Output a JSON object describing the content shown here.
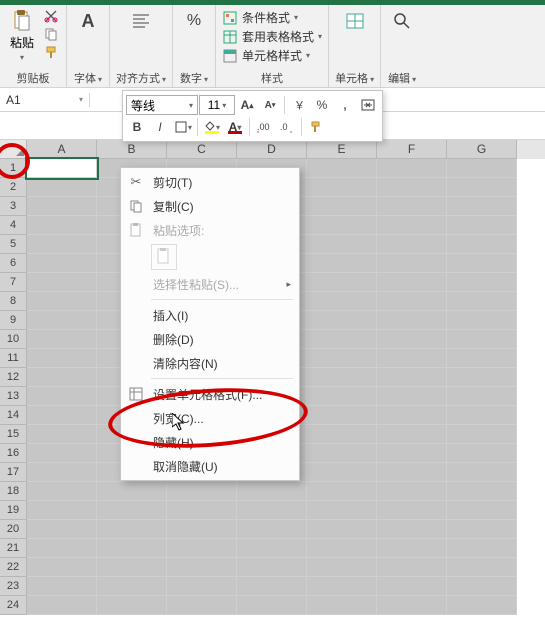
{
  "ribbon": {
    "clipboard": {
      "label": "剪贴板",
      "paste": "粘贴"
    },
    "font": {
      "label": "字体"
    },
    "alignment": {
      "label": "对齐方式"
    },
    "number": {
      "label": "数字"
    },
    "styles": {
      "label": "样式",
      "conditional": "条件格式",
      "formatTable": "套用表格格式",
      "cellStyles": "单元格样式"
    },
    "cells": {
      "label": "单元格"
    },
    "editing": {
      "label": "编辑"
    }
  },
  "mini": {
    "font": "等线",
    "size": "11",
    "bold": "B",
    "italic": "I",
    "percent": "%",
    "comma": ","
  },
  "namebox": {
    "value": "A1"
  },
  "columns": [
    "A",
    "B",
    "C",
    "D",
    "E",
    "F",
    "G"
  ],
  "rowcount": 24,
  "ctx": {
    "cut": "剪切(T)",
    "copy": "复制(C)",
    "pasteOptions": "粘贴选项:",
    "pasteSpecial": "选择性粘贴(S)...",
    "insert": "插入(I)",
    "delete": "删除(D)",
    "clear": "清除内容(N)",
    "formatCells": "设置单元格格式(F)...",
    "columnWidth": "列宽(C)...",
    "hide": "隐藏(H)",
    "unhide": "取消隐藏(U)"
  }
}
